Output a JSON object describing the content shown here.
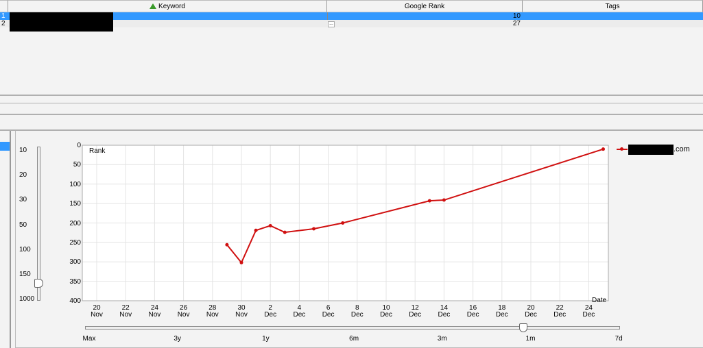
{
  "table": {
    "columns": [
      {
        "label": "Keyword",
        "sort_icon": "sort-ascending-icon"
      },
      {
        "label": "Google Rank"
      },
      {
        "label": "Tags"
      }
    ],
    "rows": [
      {
        "index": "1",
        "keyword": "",
        "rank": "10",
        "tags": "",
        "selected": true
      },
      {
        "index": "2",
        "keyword": "",
        "rank": "27",
        "tags": "",
        "selected": false
      }
    ],
    "ellipsis_label": "..."
  },
  "zoom_slider": {
    "labels": [
      "10",
      "20",
      "30",
      "50",
      "100",
      "150",
      "1000"
    ],
    "selected": "150"
  },
  "range_slider": {
    "labels": [
      "Max",
      "3y",
      "1y",
      "6m",
      "3m",
      "1m",
      "7d"
    ],
    "selected": "1m"
  },
  "legend": {
    "series_suffix": ".com"
  },
  "colors": {
    "selection": "#3399ff",
    "series": "#d01010"
  },
  "chart_data": {
    "type": "line",
    "ylabel": "Rank",
    "xlabel": "Date",
    "ylim": [
      400,
      0
    ],
    "yticks": [
      "0",
      "50",
      "100",
      "150",
      "200",
      "250",
      "300",
      "350",
      "400"
    ],
    "xticks": [
      [
        "20",
        "Nov"
      ],
      [
        "22",
        "Nov"
      ],
      [
        "24",
        "Nov"
      ],
      [
        "26",
        "Nov"
      ],
      [
        "28",
        "Nov"
      ],
      [
        "30",
        "Nov"
      ],
      [
        "2",
        "Dec"
      ],
      [
        "4",
        "Dec"
      ],
      [
        "6",
        "Dec"
      ],
      [
        "8",
        "Dec"
      ],
      [
        "10",
        "Dec"
      ],
      [
        "12",
        "Dec"
      ],
      [
        "14",
        "Dec"
      ],
      [
        "16",
        "Dec"
      ],
      [
        "18",
        "Dec"
      ],
      [
        "20",
        "Dec"
      ],
      [
        "22",
        "Dec"
      ],
      [
        "24",
        "Dec"
      ]
    ],
    "grid": true,
    "legend_position": "right",
    "series": [
      {
        "name": ".com",
        "x": [
          "29 Nov",
          "30 Nov",
          "1 Dec",
          "2 Dec",
          "3 Dec",
          "5 Dec",
          "7 Dec",
          "13 Dec",
          "14 Dec",
          "25 Dec"
        ],
        "values": [
          256,
          302,
          219,
          207,
          224,
          215,
          200,
          143,
          141,
          10
        ]
      }
    ]
  }
}
